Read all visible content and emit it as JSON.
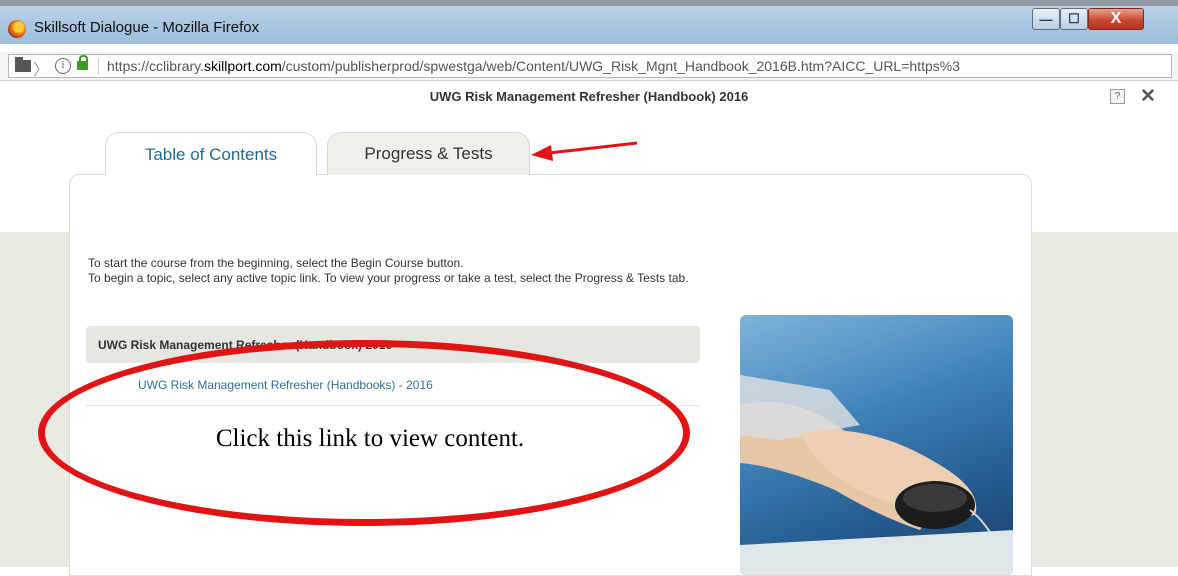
{
  "window": {
    "title": "Skillsoft Dialogue - Mozilla Firefox",
    "controls": {
      "minimize": "—",
      "maximize": "☐",
      "close": "X"
    }
  },
  "urlbar": {
    "url_prefix": "https://cclibrary.",
    "url_domain": "skillport.com",
    "url_rest": "/custom/publisherprod/spwestga/web/Content/UWG_Risk_Mgnt_Handbook_2016B.htm?AICC_URL=https%3",
    "info_glyph": "i"
  },
  "dialog": {
    "title": "UWG Risk Management Refresher (Handbook) 2016",
    "help_label": "?",
    "close_label": "✕"
  },
  "tabs": {
    "toc_label": "Table of Contents",
    "progress_label": "Progress & Tests"
  },
  "content": {
    "intro_line1": "To start the course from the beginning, select the Begin Course button.",
    "intro_line2": "To begin a topic, select any active topic link. To view your progress or take a test, select the Progress & Tests tab.",
    "course_header": "UWG Risk Management Refresher (Handbook) 2016",
    "topic_link": "UWG Risk Management Refresher (Handbooks) - 2016"
  },
  "annotation": {
    "callout_text": "Click this link to view content.",
    "color": "#e01414"
  },
  "colors": {
    "tab_active_text": "#1f6b93",
    "link": "#2f6f95",
    "panel_gray": "#e9ebe3"
  }
}
